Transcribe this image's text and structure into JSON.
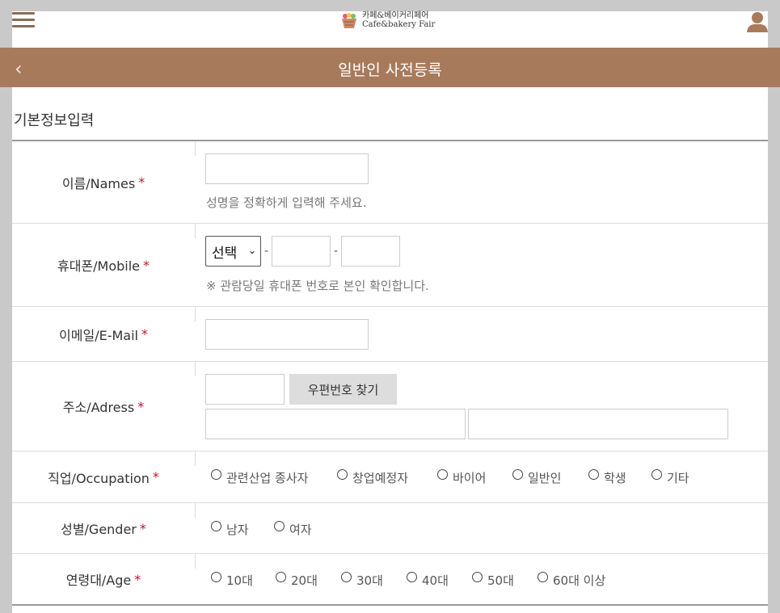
{
  "logo": {
    "line1": "카페&베이커리페어",
    "line2": "Cafe&bakery Fair"
  },
  "header": {
    "back_icon": "chevron-left-icon",
    "title": "일반인 사전등록"
  },
  "section": {
    "title": "기본정보입력"
  },
  "form": {
    "name": {
      "label": "이름/Names",
      "required": "*",
      "value": "",
      "hint": "성명을 정확하게 입력해 주세요."
    },
    "mobile": {
      "label": "휴대폰/Mobile",
      "required": "*",
      "select_value": "선택",
      "sep": "-",
      "hint": "※ 관람당일 휴대폰 번호로 본인 확인합니다."
    },
    "email": {
      "label": "이메일/E-Mail",
      "required": "*",
      "value": ""
    },
    "address": {
      "label": "주소/Adress",
      "required": "*",
      "zip_button": "우편번호 찾기"
    },
    "occupation": {
      "label": "직업/Occupation",
      "required": "*",
      "options": [
        "관련산업 종사자",
        "창업예정자",
        "바이어",
        "일반인",
        "학생",
        "기타"
      ]
    },
    "gender": {
      "label": "성별/Gender",
      "required": "*",
      "options": [
        "남자",
        "여자"
      ]
    },
    "age": {
      "label": "연령대/Age",
      "required": "*",
      "options": [
        "10대",
        "20대",
        "30대",
        "40대",
        "50대",
        "60대 이상"
      ]
    }
  },
  "colors": {
    "header_bg": "#a87a5c",
    "required": "#c8102e",
    "page_bg": "#c9c9c9"
  }
}
